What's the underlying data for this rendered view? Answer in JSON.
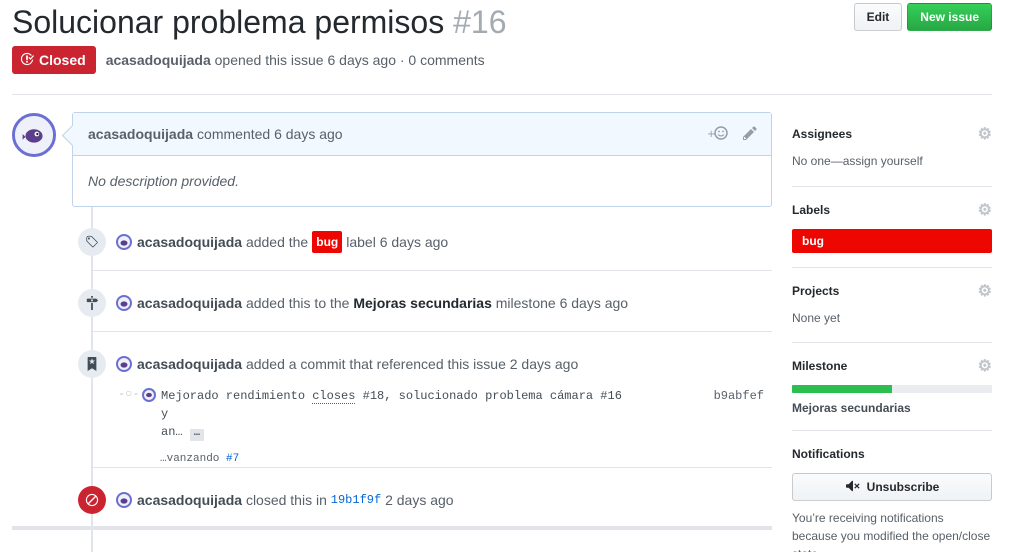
{
  "header": {
    "title": "Solucionar problema permisos",
    "number": "#16",
    "edit_label": "Edit",
    "new_issue_label": "New issue"
  },
  "meta": {
    "state": "Closed",
    "author": "acasadoquijada",
    "opened_text": "opened this issue 6 days ago · 0 comments"
  },
  "comment": {
    "author": "acasadoquijada",
    "when": "commented 6 days ago",
    "body": "No description provided."
  },
  "timeline": {
    "label_event": {
      "author": "acasadoquijada",
      "pre": "added the",
      "label": "bug",
      "post": "label 6 days ago"
    },
    "milestone_event": {
      "author": "acasadoquijada",
      "pre": "added this to the",
      "milestone": "Mejoras secundarias",
      "post": "milestone 6 days ago"
    },
    "commit_event": {
      "author": "acasadoquijada",
      "text": "added a commit that referenced this issue 2 days ago"
    },
    "commit": {
      "msg_pre": "Mejorado rendimiento",
      "msg_closes": "closes",
      "msg_mid": "#18, solucionado problema cámara #16 y",
      "msg_line2": "an…",
      "ellipsis": "…",
      "sha": "b9abfef",
      "desc_pre": "…vanzando",
      "desc_link": "#7"
    },
    "closed_event": {
      "author": "acasadoquijada",
      "pre": "closed this in",
      "sha": "19b1f9f",
      "post": "2 days ago"
    }
  },
  "sidebar": {
    "assignees_title": "Assignees",
    "assignees_value": "No one—assign yourself",
    "labels_title": "Labels",
    "label_bug": "bug",
    "projects_title": "Projects",
    "projects_value": "None yet",
    "milestone_title": "Milestone",
    "milestone_progress": 0.5,
    "milestone_name": "Mejoras secundarias",
    "notifications_title": "Notifications",
    "unsubscribe_label": "Unsubscribe",
    "notif_note": "You’re receiving notifications because you modified the open/close state."
  },
  "colors": {
    "closed_red": "#cb2431",
    "label_bug": "#ee0701",
    "milestone_green": "#2cbe4e",
    "primary_green": "#28a745",
    "link_blue": "#0366d6"
  },
  "icons": {
    "state": "issue-closed-icon",
    "label_event": "tag-icon",
    "milestone_event": "milestone-icon",
    "commit_event": "bookmark-icon",
    "closed_event": "circle-slash-icon",
    "reaction": "smiley-icon",
    "edit": "pencil-icon",
    "settings": "gear-icon",
    "mute": "mute-icon"
  }
}
